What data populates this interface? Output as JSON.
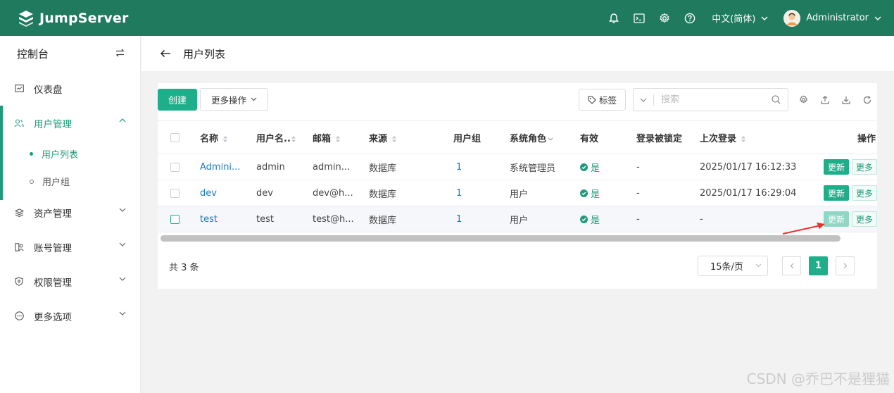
{
  "header": {
    "brand": "JumpServer",
    "language": "中文(简体)",
    "user": "Administrator",
    "icons": [
      "bell-icon",
      "terminal-icon",
      "gear-icon",
      "help-icon"
    ]
  },
  "sidebar": {
    "title": "控制台",
    "items": [
      {
        "label": "仪表盘",
        "icon": "dashboard-icon"
      },
      {
        "label": "用户管理",
        "icon": "users-icon"
      },
      {
        "label": "资产管理",
        "icon": "stack-icon"
      },
      {
        "label": "账号管理",
        "icon": "accounts-icon"
      },
      {
        "label": "权限管理",
        "icon": "shield-icon"
      },
      {
        "label": "更多选项",
        "icon": "more-icon"
      }
    ],
    "sub_items": [
      {
        "label": "用户列表"
      },
      {
        "label": "用户组"
      }
    ]
  },
  "page": {
    "title": "用户列表"
  },
  "toolbar": {
    "create_label": "创建",
    "more_ops_label": "更多操作",
    "tag_label": "标签",
    "search_placeholder": "搜索"
  },
  "table": {
    "headers": [
      "名称",
      "用户名..",
      "邮箱",
      "来源",
      "用户组",
      "系统角色",
      "有效",
      "登录被锁定",
      "上次登录",
      "操作"
    ],
    "rows": [
      {
        "name": "Admini...",
        "username": "admin",
        "email": "admin...",
        "source": "数据库",
        "groups": "1",
        "role": "系统管理员",
        "valid": "是",
        "locked": "-",
        "last_login": "2025/01/17 16:12:33",
        "update": "更新",
        "more": "更多"
      },
      {
        "name": "dev",
        "username": "dev",
        "email": "dev@h...",
        "source": "数据库",
        "groups": "1",
        "role": "用户",
        "valid": "是",
        "locked": "-",
        "last_login": "2025/01/17 16:29:04",
        "update": "更新",
        "more": "更多"
      },
      {
        "name": "test",
        "username": "test",
        "email": "test@h...",
        "source": "数据库",
        "groups": "1",
        "role": "用户",
        "valid": "是",
        "locked": "-",
        "last_login": "-",
        "update": "更新",
        "more": "更多"
      }
    ]
  },
  "pagination": {
    "total": "共 3 条",
    "page_size": "15条/页",
    "current_page": "1"
  },
  "watermark": "CSDN @乔巴不是狸猫",
  "colors": {
    "topbar": "#1f7a5e",
    "accent": "#1fae8a",
    "link": "#1f7ab8",
    "annotation_arrow": "#e8322b"
  }
}
